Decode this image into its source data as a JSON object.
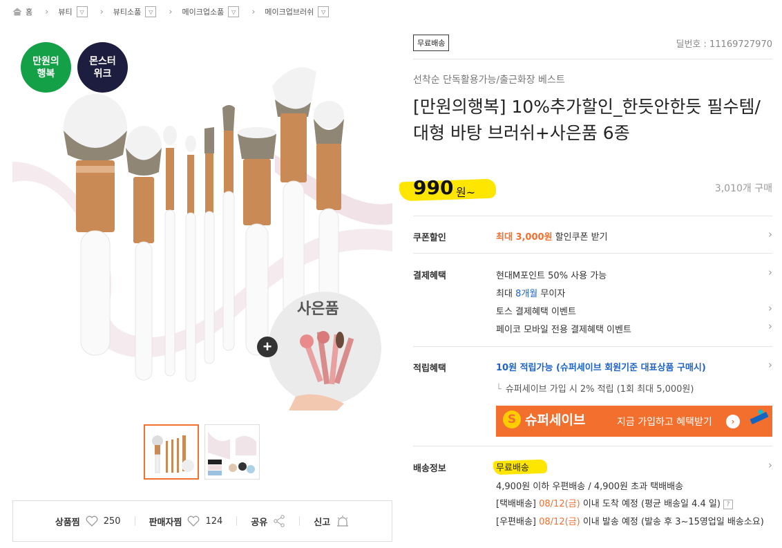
{
  "breadcrumb": {
    "home": "홈",
    "items": [
      "뷰티",
      "뷰티소품",
      "메이크업소품",
      "메이크업브러쉬"
    ]
  },
  "product_image": {
    "badge_left": "만원의\n행복",
    "badge_right": "몬스터\n위크",
    "gift_label": "사은품"
  },
  "actions": {
    "wish_label": "상품찜",
    "wish_count": "250",
    "seller_label": "판매자찜",
    "seller_count": "124",
    "share_label": "공유",
    "report_label": "신고"
  },
  "product": {
    "free_tag": "무료배송",
    "deal_no": "딜번호 : 11169727970",
    "subtitle": "선착순 단독활용가능/출근화장 베스트",
    "title": "[만원의행복] 10%추가할인_한듯안한듯 필수템/대형 바탕 브러쉬+사은품 6종",
    "price": "990",
    "price_unit": "원~",
    "sold": "3,010개 구매"
  },
  "coupon": {
    "label": "쿠폰할인",
    "amount": "최대 3,000원",
    "text": " 할인쿠폰 받기"
  },
  "payment": {
    "label": "결제혜택",
    "line1": "현대M포인트 50% 사용 가능",
    "line2_pre": "최대 ",
    "line2_hl": "8개월",
    "line2_post": " 무이자",
    "line3": "토스 결제혜택 이벤트",
    "line4": "페이코 모바일 전용 결제혜택 이벤트"
  },
  "points": {
    "label": "적립혜택",
    "main": "10원 적립가능 (슈퍼세이브 회원기준 대표상품 구매시)",
    "sub": "슈퍼세이브 가입 시 2% 적립 (1회 최대 5,000원)",
    "banner_logo": "슈퍼세이브",
    "banner_text": "지금 가입하고 혜택받기"
  },
  "shipping": {
    "label": "배송정보",
    "free": "무료배송",
    "line1": "4,900원 이하 우편배송 / 4,900원 초과 택배배송",
    "line2_pre": "[택배배송] ",
    "line2_date": "08/12(금)",
    "line2_post": " 이내 도착 예정 (평균 배송일 4.4 일)",
    "line3_pre": "[우편배송] ",
    "line3_date": "08/12(금)",
    "line3_post": " 이내 발송 예정 (발송 후 3~15영업일 배송소요)"
  },
  "colors": {
    "accent": "#f36f2e",
    "highlight": "#ffe600",
    "link_blue": "#1e63c6"
  }
}
